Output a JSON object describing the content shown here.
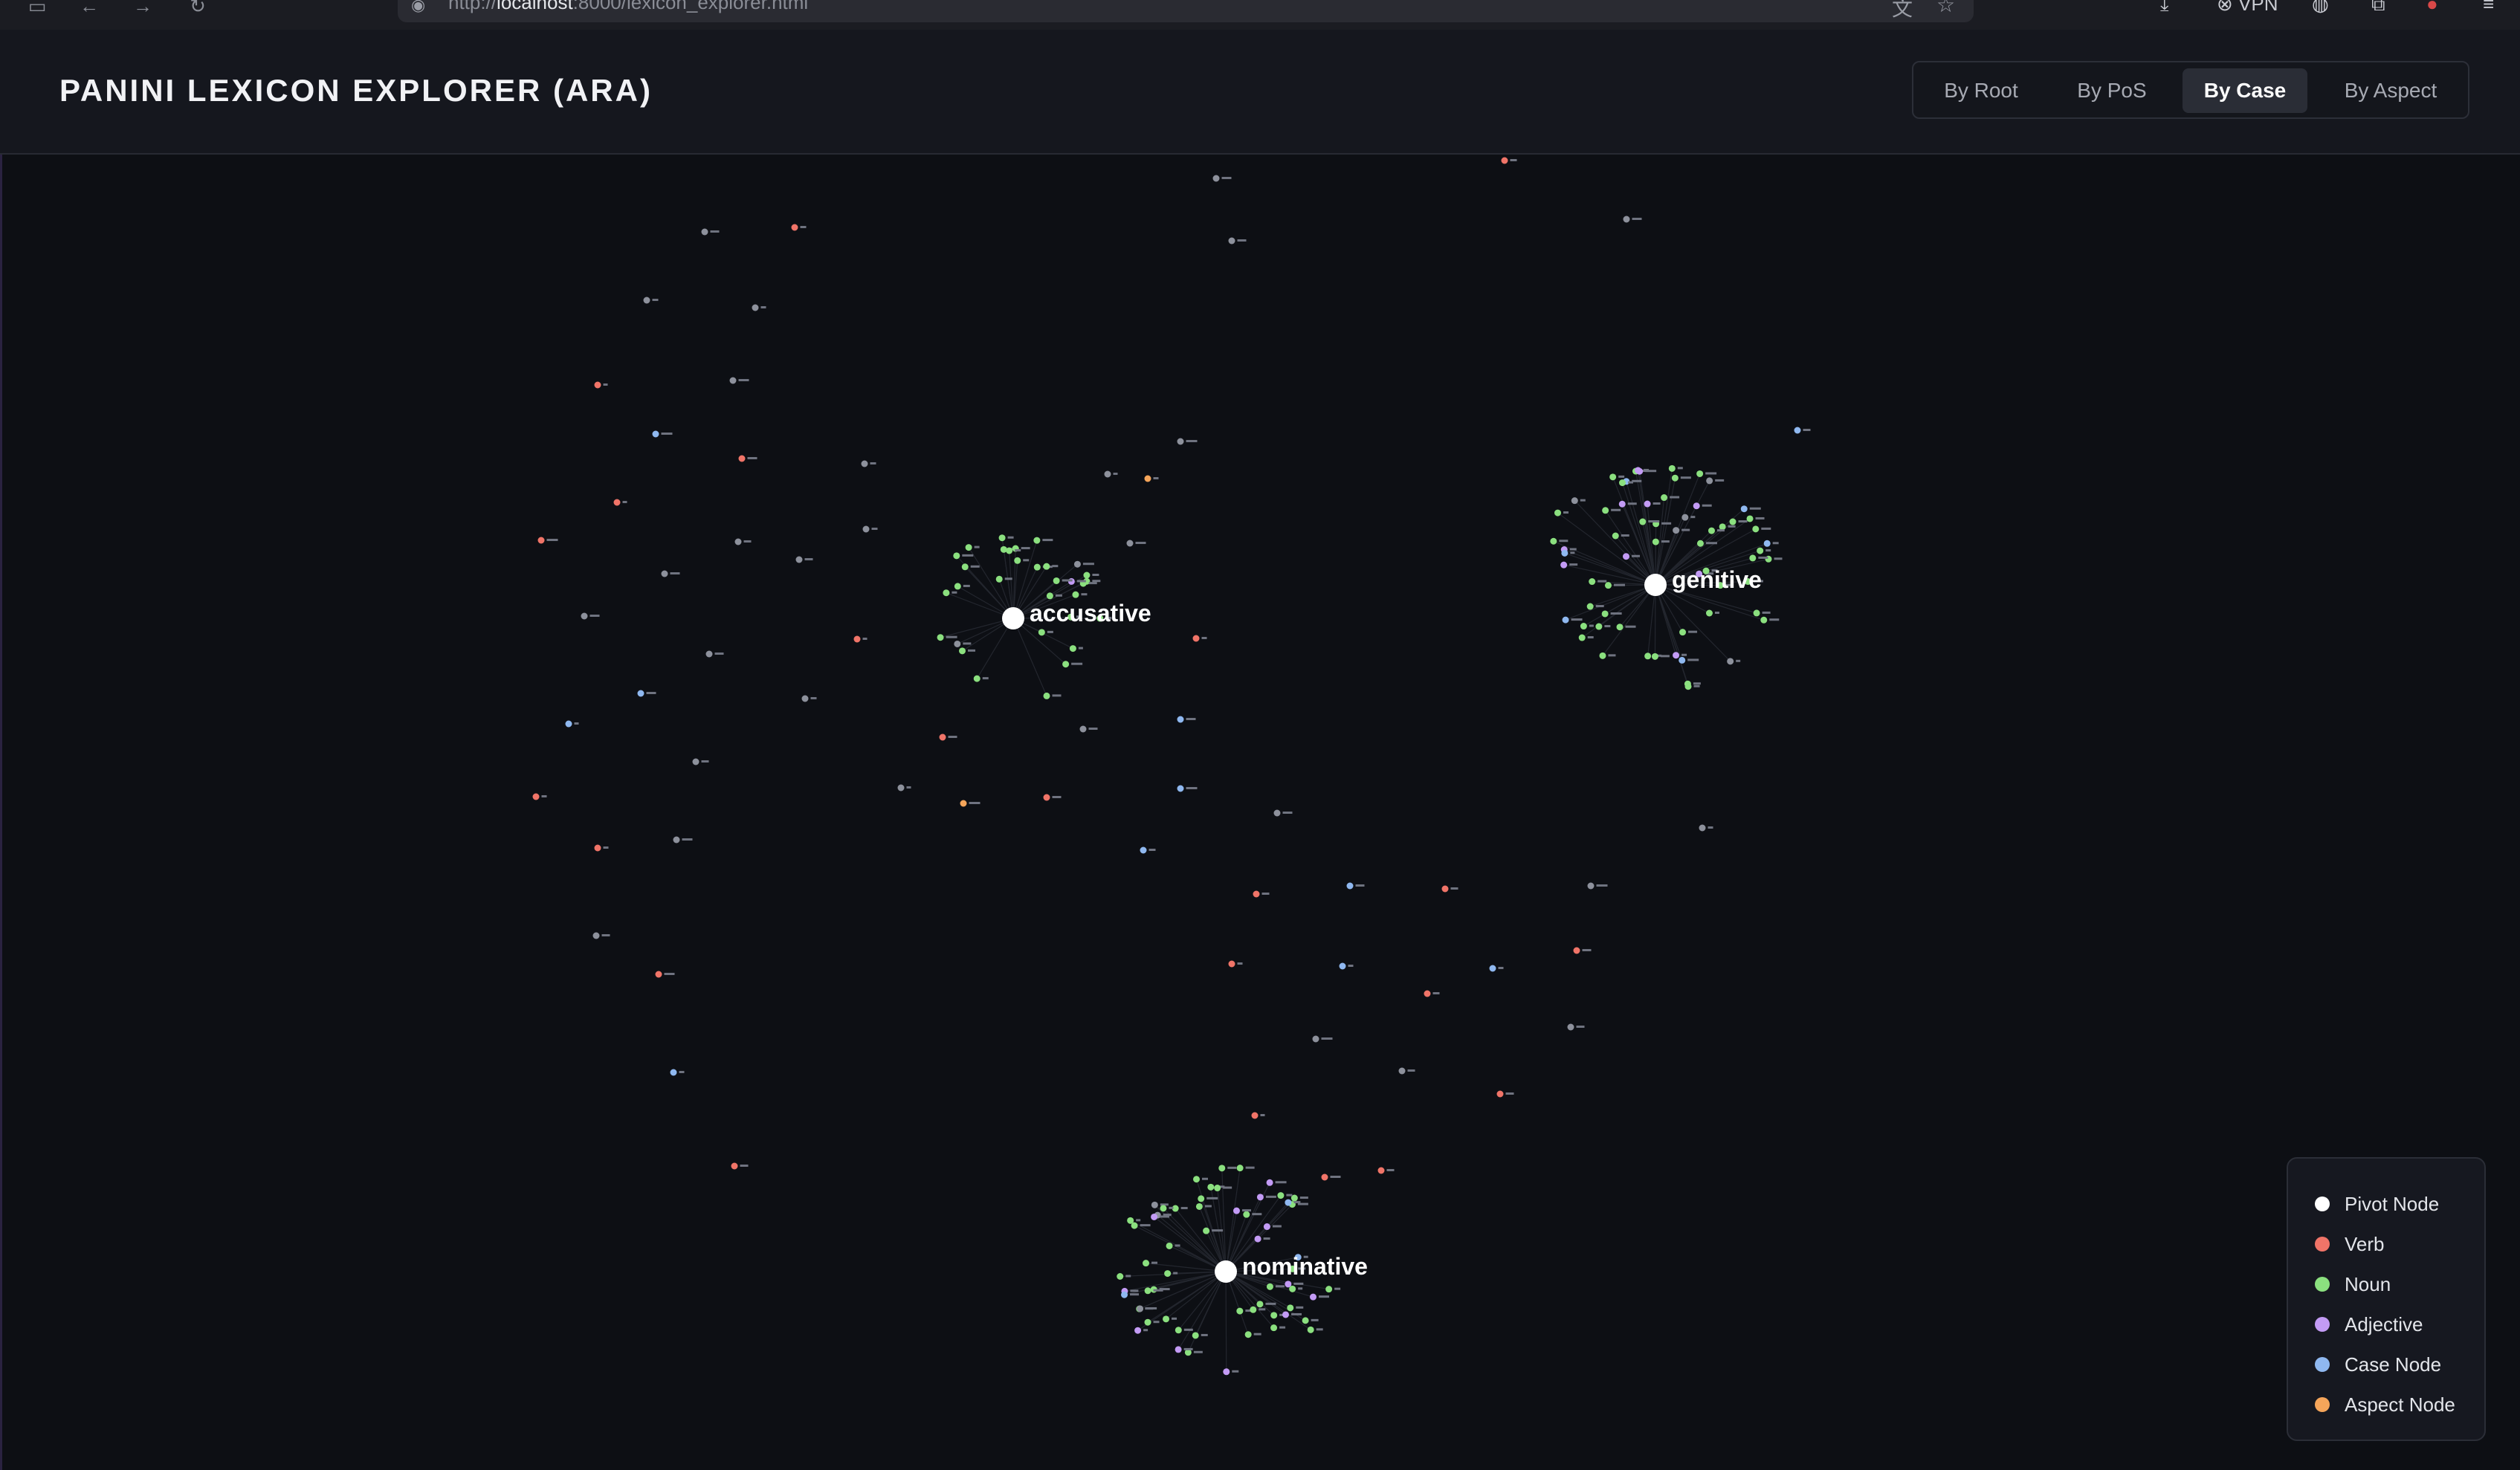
{
  "browser": {
    "url_prefix": "http://",
    "url_host": "localhost",
    "url_rest": ":8000/lexicon_explorer.html",
    "vpn_label": "VPN"
  },
  "app": {
    "title": "PANINI LEXICON EXPLORER (ARA)"
  },
  "view_modes": [
    {
      "label": "By Root",
      "active": false
    },
    {
      "label": "By PoS",
      "active": false
    },
    {
      "label": "By Case",
      "active": true
    },
    {
      "label": "By Aspect",
      "active": false
    }
  ],
  "graph": {
    "pivots": [
      {
        "label": "accusative"
      },
      {
        "label": "genitive"
      },
      {
        "label": "nominative"
      }
    ]
  },
  "legend": {
    "items": [
      {
        "label": "Pivot Node",
        "color": "#ffffff"
      },
      {
        "label": "Verb",
        "color": "#f07468"
      },
      {
        "label": "Noun",
        "color": "#8be07f"
      },
      {
        "label": "Adjective",
        "color": "#c39bf5"
      },
      {
        "label": "Case Node",
        "color": "#8fb8f0"
      },
      {
        "label": "Aspect Node",
        "color": "#f5a55a"
      }
    ]
  },
  "colors": {
    "background": "#0d0f14",
    "header": "#15171e",
    "unassigned_node": "#8d919c",
    "edge": "#2a2d36"
  }
}
